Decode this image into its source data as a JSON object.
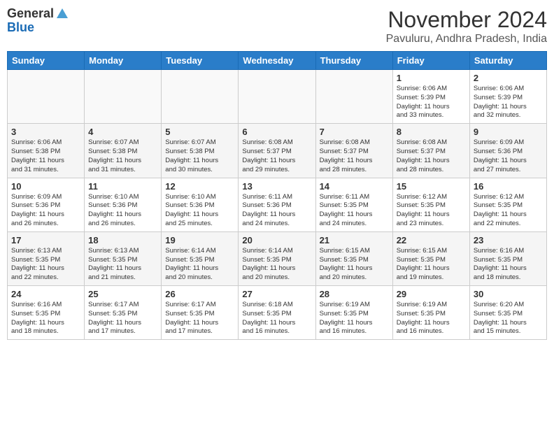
{
  "header": {
    "logo_line1": "General",
    "logo_line2": "Blue",
    "title": "November 2024",
    "subtitle": "Pavuluru, Andhra Pradesh, India"
  },
  "calendar": {
    "days_of_week": [
      "Sunday",
      "Monday",
      "Tuesday",
      "Wednesday",
      "Thursday",
      "Friday",
      "Saturday"
    ],
    "weeks": [
      [
        {
          "day": "",
          "info": ""
        },
        {
          "day": "",
          "info": ""
        },
        {
          "day": "",
          "info": ""
        },
        {
          "day": "",
          "info": ""
        },
        {
          "day": "",
          "info": ""
        },
        {
          "day": "1",
          "info": "Sunrise: 6:06 AM\nSunset: 5:39 PM\nDaylight: 11 hours\nand 33 minutes."
        },
        {
          "day": "2",
          "info": "Sunrise: 6:06 AM\nSunset: 5:39 PM\nDaylight: 11 hours\nand 32 minutes."
        }
      ],
      [
        {
          "day": "3",
          "info": "Sunrise: 6:06 AM\nSunset: 5:38 PM\nDaylight: 11 hours\nand 31 minutes."
        },
        {
          "day": "4",
          "info": "Sunrise: 6:07 AM\nSunset: 5:38 PM\nDaylight: 11 hours\nand 31 minutes."
        },
        {
          "day": "5",
          "info": "Sunrise: 6:07 AM\nSunset: 5:38 PM\nDaylight: 11 hours\nand 30 minutes."
        },
        {
          "day": "6",
          "info": "Sunrise: 6:08 AM\nSunset: 5:37 PM\nDaylight: 11 hours\nand 29 minutes."
        },
        {
          "day": "7",
          "info": "Sunrise: 6:08 AM\nSunset: 5:37 PM\nDaylight: 11 hours\nand 28 minutes."
        },
        {
          "day": "8",
          "info": "Sunrise: 6:08 AM\nSunset: 5:37 PM\nDaylight: 11 hours\nand 28 minutes."
        },
        {
          "day": "9",
          "info": "Sunrise: 6:09 AM\nSunset: 5:36 PM\nDaylight: 11 hours\nand 27 minutes."
        }
      ],
      [
        {
          "day": "10",
          "info": "Sunrise: 6:09 AM\nSunset: 5:36 PM\nDaylight: 11 hours\nand 26 minutes."
        },
        {
          "day": "11",
          "info": "Sunrise: 6:10 AM\nSunset: 5:36 PM\nDaylight: 11 hours\nand 26 minutes."
        },
        {
          "day": "12",
          "info": "Sunrise: 6:10 AM\nSunset: 5:36 PM\nDaylight: 11 hours\nand 25 minutes."
        },
        {
          "day": "13",
          "info": "Sunrise: 6:11 AM\nSunset: 5:36 PM\nDaylight: 11 hours\nand 24 minutes."
        },
        {
          "day": "14",
          "info": "Sunrise: 6:11 AM\nSunset: 5:35 PM\nDaylight: 11 hours\nand 24 minutes."
        },
        {
          "day": "15",
          "info": "Sunrise: 6:12 AM\nSunset: 5:35 PM\nDaylight: 11 hours\nand 23 minutes."
        },
        {
          "day": "16",
          "info": "Sunrise: 6:12 AM\nSunset: 5:35 PM\nDaylight: 11 hours\nand 22 minutes."
        }
      ],
      [
        {
          "day": "17",
          "info": "Sunrise: 6:13 AM\nSunset: 5:35 PM\nDaylight: 11 hours\nand 22 minutes."
        },
        {
          "day": "18",
          "info": "Sunrise: 6:13 AM\nSunset: 5:35 PM\nDaylight: 11 hours\nand 21 minutes."
        },
        {
          "day": "19",
          "info": "Sunrise: 6:14 AM\nSunset: 5:35 PM\nDaylight: 11 hours\nand 20 minutes."
        },
        {
          "day": "20",
          "info": "Sunrise: 6:14 AM\nSunset: 5:35 PM\nDaylight: 11 hours\nand 20 minutes."
        },
        {
          "day": "21",
          "info": "Sunrise: 6:15 AM\nSunset: 5:35 PM\nDaylight: 11 hours\nand 20 minutes."
        },
        {
          "day": "22",
          "info": "Sunrise: 6:15 AM\nSunset: 5:35 PM\nDaylight: 11 hours\nand 19 minutes."
        },
        {
          "day": "23",
          "info": "Sunrise: 6:16 AM\nSunset: 5:35 PM\nDaylight: 11 hours\nand 18 minutes."
        }
      ],
      [
        {
          "day": "24",
          "info": "Sunrise: 6:16 AM\nSunset: 5:35 PM\nDaylight: 11 hours\nand 18 minutes."
        },
        {
          "day": "25",
          "info": "Sunrise: 6:17 AM\nSunset: 5:35 PM\nDaylight: 11 hours\nand 17 minutes."
        },
        {
          "day": "26",
          "info": "Sunrise: 6:17 AM\nSunset: 5:35 PM\nDaylight: 11 hours\nand 17 minutes."
        },
        {
          "day": "27",
          "info": "Sunrise: 6:18 AM\nSunset: 5:35 PM\nDaylight: 11 hours\nand 16 minutes."
        },
        {
          "day": "28",
          "info": "Sunrise: 6:19 AM\nSunset: 5:35 PM\nDaylight: 11 hours\nand 16 minutes."
        },
        {
          "day": "29",
          "info": "Sunrise: 6:19 AM\nSunset: 5:35 PM\nDaylight: 11 hours\nand 16 minutes."
        },
        {
          "day": "30",
          "info": "Sunrise: 6:20 AM\nSunset: 5:35 PM\nDaylight: 11 hours\nand 15 minutes."
        }
      ]
    ]
  }
}
